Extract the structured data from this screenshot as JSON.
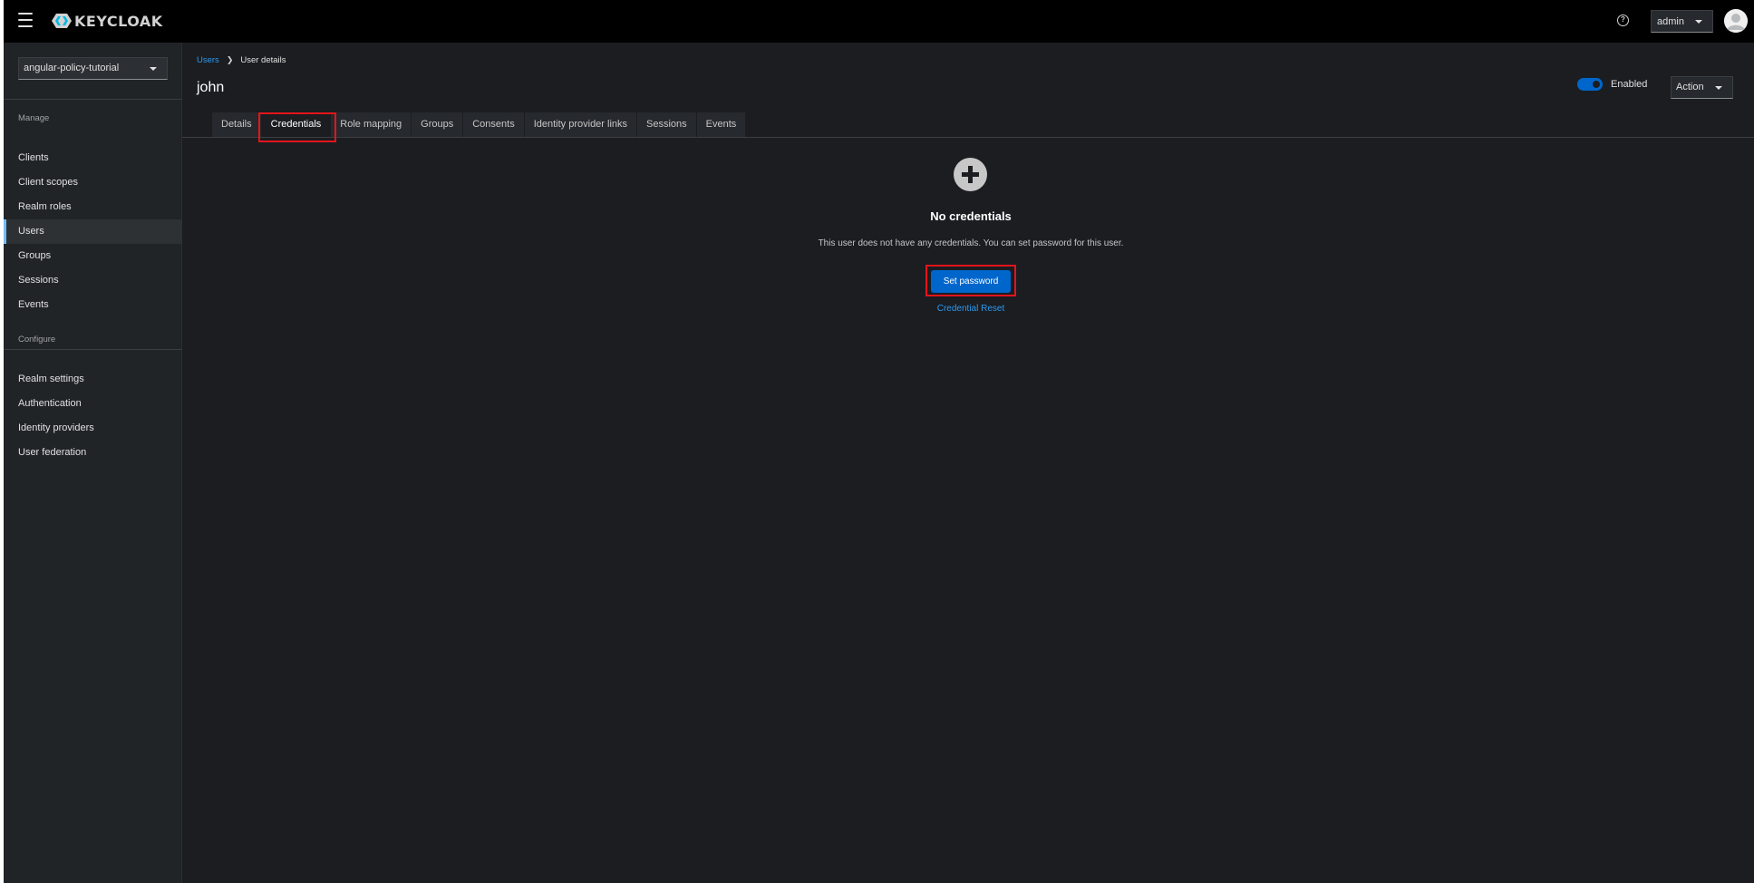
{
  "header": {
    "brand": "KEYCLOAK",
    "user_menu_label": "admin"
  },
  "sidebar": {
    "realm": "angular-policy-tutorial",
    "manage_title": "Manage",
    "manage_items": [
      {
        "label": "Clients"
      },
      {
        "label": "Client scopes"
      },
      {
        "label": "Realm roles"
      },
      {
        "label": "Users",
        "active": true
      },
      {
        "label": "Groups"
      },
      {
        "label": "Sessions"
      },
      {
        "label": "Events"
      }
    ],
    "configure_title": "Configure",
    "configure_items": [
      {
        "label": "Realm settings"
      },
      {
        "label": "Authentication"
      },
      {
        "label": "Identity providers"
      },
      {
        "label": "User federation"
      }
    ]
  },
  "breadcrumb": {
    "parent": "Users",
    "current": "User details"
  },
  "page": {
    "title": "john",
    "enabled_label": "Enabled",
    "enabled": true,
    "action_label": "Action"
  },
  "tabs": [
    {
      "label": "Details"
    },
    {
      "label": "Credentials",
      "selected": true
    },
    {
      "label": "Role mapping"
    },
    {
      "label": "Groups"
    },
    {
      "label": "Consents"
    },
    {
      "label": "Identity provider links"
    },
    {
      "label": "Sessions"
    },
    {
      "label": "Events"
    }
  ],
  "empty_state": {
    "icon": "plus-circle-icon",
    "title": "No credentials",
    "body": "This user does not have any credentials. You can set password for this user.",
    "primary_button": "Set password",
    "secondary_link": "Credential Reset"
  },
  "colors": {
    "accent": "#0066cc",
    "link": "#2b9af3",
    "highlight": "#e3141b",
    "background": "#1b1d21",
    "masthead": "#000000"
  }
}
